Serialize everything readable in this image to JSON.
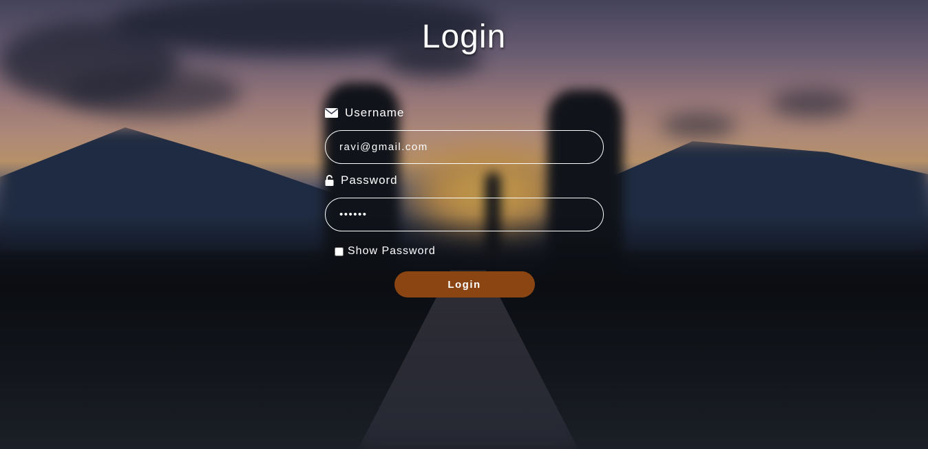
{
  "page": {
    "title": "Login"
  },
  "form": {
    "username": {
      "label": "Username",
      "icon": "envelope-icon",
      "value": "ravi@gmail.com"
    },
    "password": {
      "label": "Password",
      "icon": "unlock-icon",
      "value": "123456"
    },
    "show_password": {
      "label": "Show Password",
      "checked": false
    },
    "submit_label": "Login"
  },
  "colors": {
    "button": "#8b4513",
    "text": "#ffffff"
  }
}
